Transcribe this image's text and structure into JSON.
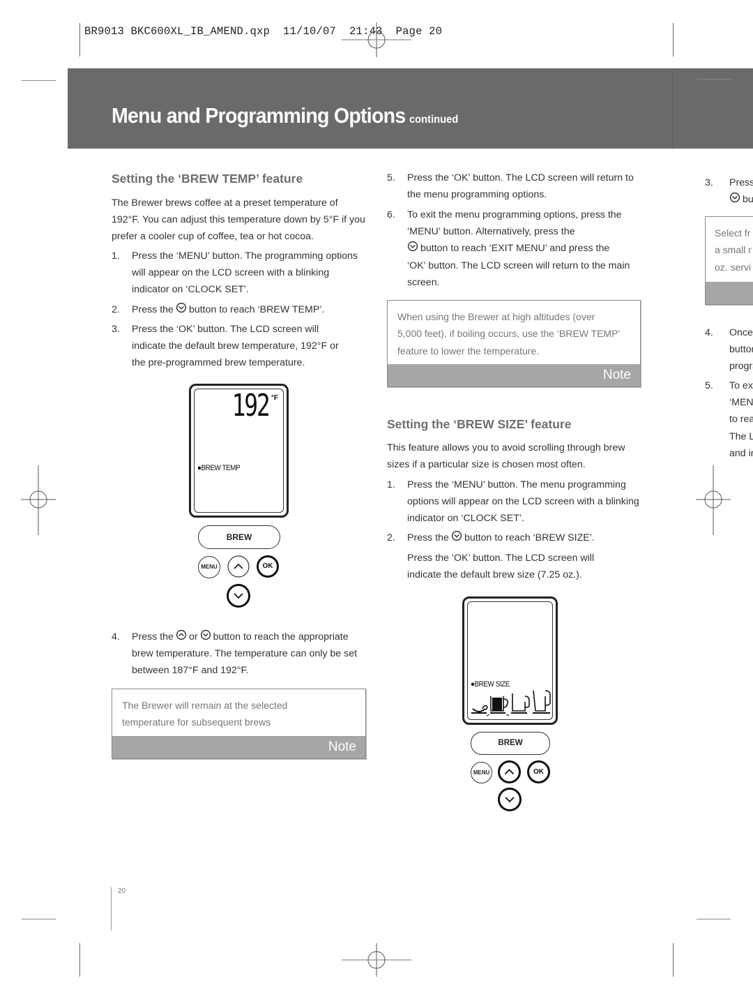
{
  "slug": "BR9013 BKC600XL_IB_AMEND.qxp  11/10/07  21:43  Page 20",
  "header": {
    "title": "Menu and Programming Options",
    "continued": "continued"
  },
  "brew_temp": {
    "heading": "Setting the ‘BREW TEMP’ feature",
    "intro": "The Brewer brews coffee at a preset temperature of 192°F. You can adjust this temperature down by 5°F if you prefer a cooler cup of coffee, tea or hot cocoa.",
    "steps": [
      {
        "num": "1.",
        "text": "Press the ‘MENU’ button. The programming options will appear on the LCD screen with a blinking indicator on ‘CLOCK SET’."
      },
      {
        "num": "2.",
        "pre": "Press the",
        "icon": "down-arrow-button-icon",
        "post": "button to reach ‘BREW TEMP’."
      },
      {
        "num": "3.",
        "text": "Press the ‘OK’ button. The LCD screen will indicate the default brew temperature, 192°F or the pre-programmed brew temperature."
      },
      {
        "num": "4.",
        "pre": "Press the",
        "icon1": "up-arrow-button-icon",
        "mid": "or",
        "icon2": "down-arrow-button-icon",
        "post": "button to reach the appropriate brew temperature. The temperature can only be set between 187°F and 192°F."
      }
    ],
    "display": {
      "value": "192",
      "unit": "°F",
      "indicator": "●BREW TEMP",
      "brew_button": "BREW",
      "menu_button": "MENU",
      "ok_button": "OK"
    },
    "note": {
      "text": "The Brewer will remain at the selected temperature for subsequent brews",
      "label": "Note"
    }
  },
  "middle": {
    "steps": [
      {
        "num": "5.",
        "text": "Press the ‘OK’ button. The LCD screen will return to the menu programming options."
      },
      {
        "num": "6.",
        "text_a": "To exit the menu programming options, press the ‘MENU’ button. Alternatively, press the",
        "icon": "down-arrow-button-icon",
        "text_b": "button to reach ‘EXIT MENU’ and press the ‘OK’ button. The LCD screen will return to the main screen."
      }
    ],
    "note": {
      "text": "When using the Brewer at high altitudes (over 5,000 feet), if boiling occurs, use the ‘BREW TEMP’ feature to lower the temperature.",
      "label": "Note"
    }
  },
  "brew_size": {
    "heading": "Setting the ‘BREW SIZE’ feature",
    "intro": "This feature allows you to avoid scrolling through brew sizes if a particular size is chosen most often.",
    "steps": [
      {
        "num": "1.",
        "text": "Press the ‘MENU’ button. The menu programming options will appear on the LCD screen with a blinking indicator on ‘CLOCK SET’."
      },
      {
        "num": "2.",
        "pre": "Press the",
        "icon": "down-arrow-button-icon",
        "post": "button to reach ‘BREW SIZE’."
      },
      {
        "num": "",
        "text": "Press the ‘OK’ button. The LCD screen will indicate the default brew size (7.25 oz.)."
      }
    ],
    "display": {
      "indicator": "●BREW SIZE",
      "selected_size_index": 1,
      "brew_button": "BREW",
      "menu_button": "MENU",
      "ok_button": "OK"
    }
  },
  "right_partial": {
    "steps": [
      {
        "num": "3.",
        "line1": "Press",
        "line2": "bu"
      },
      {
        "num": "4.",
        "lines": [
          "Once",
          "button",
          "progra"
        ]
      },
      {
        "num": "5.",
        "lines": [
          "To exit",
          "‘MENU",
          "to reac",
          "The LC",
          "and in"
        ]
      }
    ],
    "note_lines": [
      "Select fr",
      "a small r",
      "oz. servi"
    ]
  },
  "page_number": "20"
}
